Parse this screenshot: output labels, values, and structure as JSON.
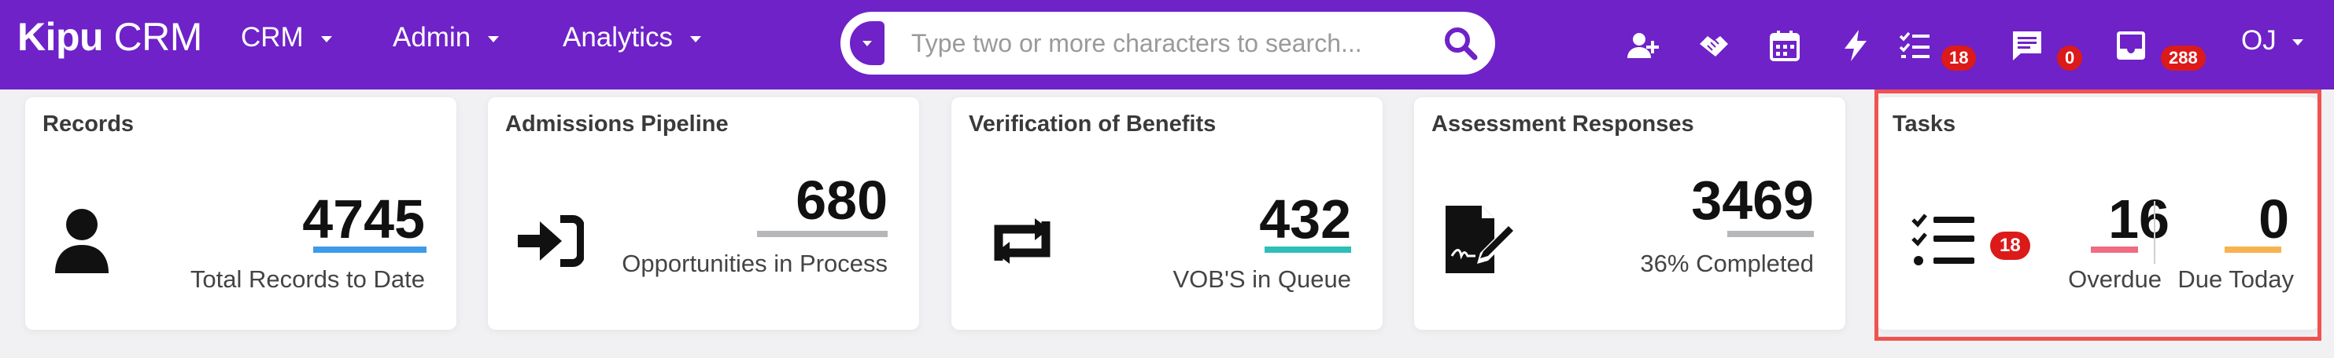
{
  "app": {
    "logo_bold": "Kipu",
    "logo_light": " CRM",
    "brand_color": "#6e22c8"
  },
  "nav": {
    "menus": [
      {
        "label": "CRM"
      },
      {
        "label": "Admin"
      },
      {
        "label": "Analytics"
      }
    ]
  },
  "search": {
    "placeholder": "Type two or more characters to search..."
  },
  "header_icons": {
    "add_user": "add-user-icon",
    "handshake": "handshake-icon",
    "calendar": "calendar-icon",
    "bolt": "lightning-icon",
    "tasks": "tasks-icon",
    "tasks_badge": "18",
    "messages": "messages-icon",
    "messages_badge": "0",
    "inbox": "inbox-icon",
    "inbox_badge": "288"
  },
  "user": {
    "initials": "OJ"
  },
  "cards": {
    "records": {
      "title": "Records",
      "value": "4745",
      "label": "Total Records to Date",
      "bar_color": "#3d9be9"
    },
    "admissions": {
      "title": "Admissions Pipeline",
      "value": "680",
      "label": "Opportunities in Process",
      "bar_color": "#b5b7bb"
    },
    "vob": {
      "title": "Verification of Benefits",
      "value": "432",
      "label": "VOB'S in Queue",
      "bar_color": "#2dbfb8"
    },
    "assessment": {
      "title": "Assessment Responses",
      "value": "3469",
      "label": "36% Completed",
      "bar_color": "#b5b7bb"
    },
    "tasks": {
      "title": "Tasks",
      "badge": "18",
      "overdue_value": "16",
      "overdue_label": "Overdue",
      "overdue_color": "#f06b84",
      "due_value": "0",
      "due_label": "Due Today",
      "due_color": "#f7b34f"
    }
  }
}
